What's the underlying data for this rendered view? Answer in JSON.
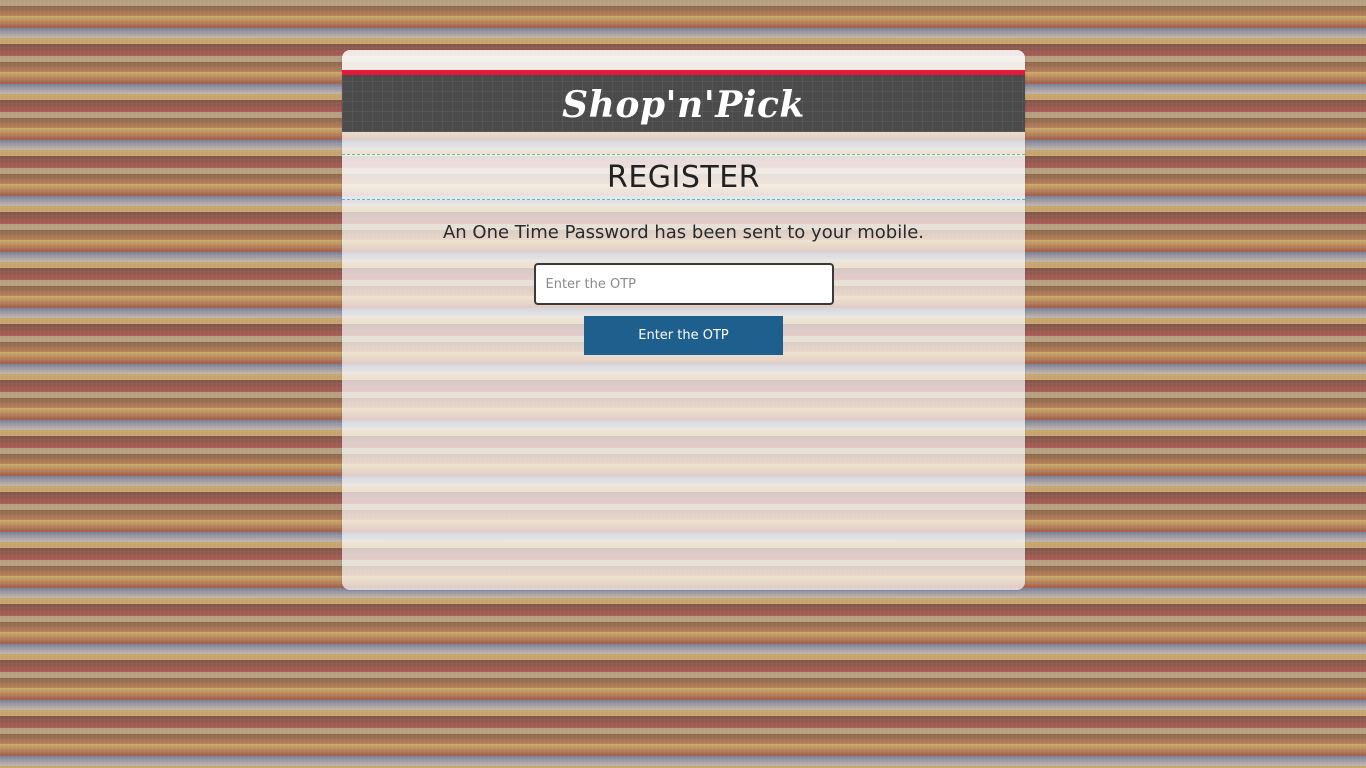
{
  "brand": {
    "logo_text": "Shop'n'Pick",
    "accent_color": "#e5173a",
    "header_color": "#4b4b4b"
  },
  "page": {
    "title": "REGISTER",
    "message": "An One Time Password has been sent to your mobile."
  },
  "otp_form": {
    "input_value": "",
    "input_placeholder": "Enter the OTP",
    "submit_label": "Enter the OTP",
    "button_color": "#1e5f8e"
  }
}
